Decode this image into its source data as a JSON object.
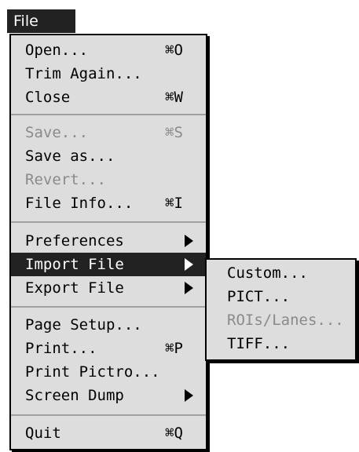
{
  "menu_bar": {
    "title": "File"
  },
  "menu": {
    "items": [
      {
        "label": "Open...",
        "shortcut": "⌘O"
      },
      {
        "label": "Trim Again...",
        "shortcut": ""
      },
      {
        "label": "Close",
        "shortcut": "⌘W"
      },
      {
        "label": "Save...",
        "shortcut": "⌘S"
      },
      {
        "label": "Save as...",
        "shortcut": ""
      },
      {
        "label": "Revert...",
        "shortcut": ""
      },
      {
        "label": "File Info...",
        "shortcut": "⌘I"
      },
      {
        "label": "Preferences",
        "shortcut": ""
      },
      {
        "label": "Import File",
        "shortcut": ""
      },
      {
        "label": "Export File",
        "shortcut": ""
      },
      {
        "label": "Page Setup...",
        "shortcut": ""
      },
      {
        "label": "Print...",
        "shortcut": "⌘P"
      },
      {
        "label": "Print Pictro...",
        "shortcut": ""
      },
      {
        "label": "Screen Dump",
        "shortcut": ""
      },
      {
        "label": "Quit",
        "shortcut": "⌘Q"
      }
    ]
  },
  "submenu": {
    "items": [
      {
        "label": "Custom..."
      },
      {
        "label": "PICT..."
      },
      {
        "label": "ROIs/Lanes..."
      },
      {
        "label": "TIFF..."
      }
    ]
  }
}
